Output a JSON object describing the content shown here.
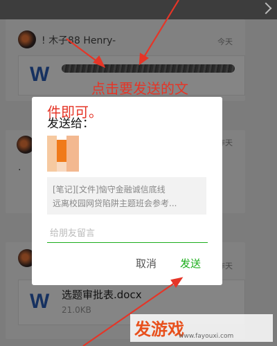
{
  "feed": {
    "sender_name": "! 木子88 Henry-",
    "date_label": "今天",
    "date_label2": "昨天",
    "date_label3": "昨天",
    "file_icon_letter": "W",
    "file2_name": "选题审批表.docx",
    "file2_size": "21.0KB",
    "dot_text": "."
  },
  "dialog": {
    "title": "发送给：",
    "preview_line1": "[笔记][文件]恼守金融诚信底线",
    "preview_line2": "远离校园网贷陷阱主题班会参考...",
    "message_placeholder": "给朋友留言",
    "cancel_label": "取消",
    "send_label": "发送"
  },
  "annotation": {
    "line1": "点击要发送的文",
    "line2": "件即可。",
    "color": "#e53527"
  },
  "watermark": {
    "logo": "发游戏",
    "url": "www.fayouxi.com"
  },
  "colors": {
    "accent_green": "#1aad19",
    "word_blue": "#2b5fb8"
  }
}
